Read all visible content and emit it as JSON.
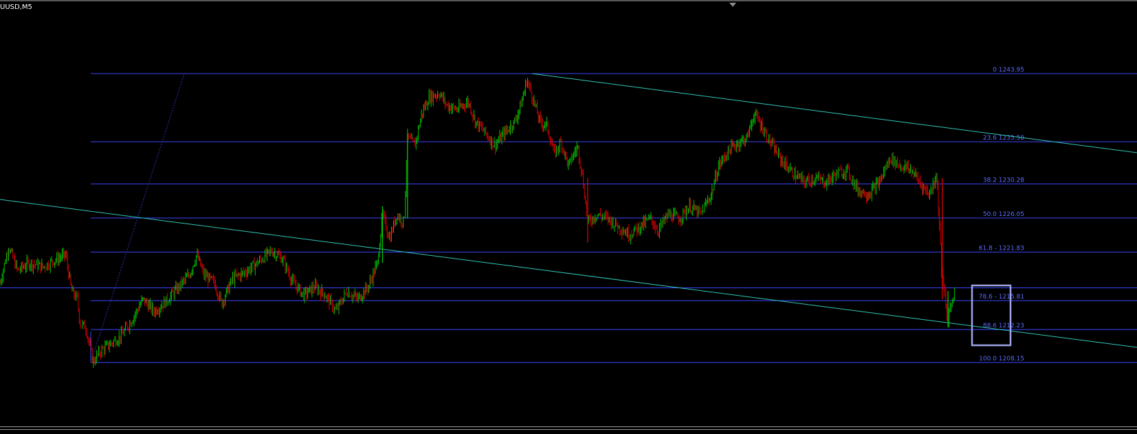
{
  "window": {
    "title": "UUSD,M5"
  },
  "colors": {
    "background": "#000000",
    "bull_candle": "#00c800",
    "bear_candle": "#e00000",
    "fib_line": "#3d45ff",
    "fib_label": "#5b6cff",
    "channel_line": "#30c8b8",
    "dotted_trend": "#2a2aa0",
    "horizontal_line": "#3d45ff",
    "highlight_box": "#a0a4e8"
  },
  "chart_data": {
    "type": "line",
    "instrument": "UUSD",
    "timeframe": "M5",
    "ylim": [
      1200,
      1251
    ],
    "fib_levels": [
      {
        "ratio": "0",
        "label": "0 1243.95",
        "price": 1243.95
      },
      {
        "ratio": "23.6",
        "label": "23.6 1235.50",
        "price": 1235.5
      },
      {
        "ratio": "38.2",
        "label": "38.2 1230.28",
        "price": 1230.28
      },
      {
        "ratio": "50.0",
        "label": "50.0 1226.05",
        "price": 1226.05
      },
      {
        "ratio": "61.8",
        "label": "61.8 - 1221.83",
        "price": 1221.83
      },
      {
        "ratio": "78.6",
        "label": "78.6 - 1215.81",
        "price": 1215.81
      },
      {
        "ratio": "88.6",
        "label": "88.6 1212.23",
        "price": 1212.23
      },
      {
        "ratio": "100.0",
        "label": "100.0 1208.15",
        "price": 1208.15
      }
    ],
    "horizontal_line_price": 1217.4,
    "price_path": [
      [
        0,
        1218.0
      ],
      [
        12,
        1222.5
      ],
      [
        25,
        1219.5
      ],
      [
        40,
        1220.5
      ],
      [
        60,
        1220.0
      ],
      [
        80,
        1221.0
      ],
      [
        92,
        1221.5
      ],
      [
        100,
        1217.0
      ],
      [
        108,
        1216.0
      ],
      [
        112,
        1213.0
      ],
      [
        120,
        1212.5
      ],
      [
        126,
        1210.0
      ],
      [
        130,
        1208.2
      ],
      [
        140,
        1209.5
      ],
      [
        155,
        1210.5
      ],
      [
        170,
        1211.5
      ],
      [
        185,
        1213.5
      ],
      [
        200,
        1216.0
      ],
      [
        215,
        1214.5
      ],
      [
        230,
        1215.5
      ],
      [
        250,
        1217.5
      ],
      [
        265,
        1219.0
      ],
      [
        275,
        1221.5
      ],
      [
        285,
        1219.0
      ],
      [
        300,
        1218.0
      ],
      [
        310,
        1215.5
      ],
      [
        325,
        1218.5
      ],
      [
        345,
        1219.5
      ],
      [
        360,
        1220.5
      ],
      [
        380,
        1222.0
      ],
      [
        395,
        1221.0
      ],
      [
        410,
        1218.0
      ],
      [
        425,
        1216.5
      ],
      [
        440,
        1217.5
      ],
      [
        455,
        1216.5
      ],
      [
        470,
        1214.5
      ],
      [
        485,
        1217.0
      ],
      [
        500,
        1216.0
      ],
      [
        515,
        1217.5
      ],
      [
        528,
        1220.5
      ],
      [
        535,
        1226.5
      ],
      [
        545,
        1223.5
      ],
      [
        555,
        1226.5
      ],
      [
        565,
        1225.5
      ],
      [
        570,
        1236.0
      ],
      [
        580,
        1235.0
      ],
      [
        590,
        1239.0
      ],
      [
        600,
        1241.0
      ],
      [
        615,
        1241.5
      ],
      [
        625,
        1240.0
      ],
      [
        640,
        1239.5
      ],
      [
        655,
        1240.5
      ],
      [
        665,
        1238.0
      ],
      [
        680,
        1236.5
      ],
      [
        692,
        1235.0
      ],
      [
        705,
        1236.5
      ],
      [
        720,
        1238.0
      ],
      [
        730,
        1240.5
      ],
      [
        737,
        1243.2
      ],
      [
        745,
        1241.0
      ],
      [
        755,
        1238.0
      ],
      [
        765,
        1237.5
      ],
      [
        775,
        1234.0
      ],
      [
        785,
        1235.5
      ],
      [
        795,
        1232.5
      ],
      [
        808,
        1235.0
      ],
      [
        815,
        1231.0
      ],
      [
        822,
        1225.5
      ],
      [
        835,
        1226.5
      ],
      [
        850,
        1226.0
      ],
      [
        865,
        1225.0
      ],
      [
        880,
        1224.0
      ],
      [
        895,
        1225.0
      ],
      [
        910,
        1226.0
      ],
      [
        920,
        1224.5
      ],
      [
        935,
        1226.5
      ],
      [
        950,
        1226.0
      ],
      [
        965,
        1227.5
      ],
      [
        980,
        1226.5
      ],
      [
        995,
        1229.0
      ],
      [
        1005,
        1232.5
      ],
      [
        1020,
        1234.5
      ],
      [
        1035,
        1235.5
      ],
      [
        1045,
        1236.0
      ],
      [
        1055,
        1239.0
      ],
      [
        1065,
        1237.5
      ],
      [
        1080,
        1235.0
      ],
      [
        1095,
        1233.0
      ],
      [
        1110,
        1231.5
      ],
      [
        1125,
        1230.5
      ],
      [
        1140,
        1231.0
      ],
      [
        1155,
        1230.5
      ],
      [
        1170,
        1231.5
      ],
      [
        1185,
        1232.0
      ],
      [
        1200,
        1229.5
      ],
      [
        1215,
        1229.0
      ],
      [
        1230,
        1230.5
      ],
      [
        1245,
        1233.5
      ],
      [
        1260,
        1232.5
      ],
      [
        1275,
        1232.0
      ],
      [
        1290,
        1230.0
      ],
      [
        1300,
        1229.0
      ],
      [
        1310,
        1231.5
      ],
      [
        1314,
        1225.0
      ],
      [
        1318,
        1218.0
      ],
      [
        1322,
        1216.5
      ],
      [
        1325,
        1213.0
      ],
      [
        1330,
        1215.5
      ],
      [
        1335,
        1217.0
      ]
    ]
  }
}
